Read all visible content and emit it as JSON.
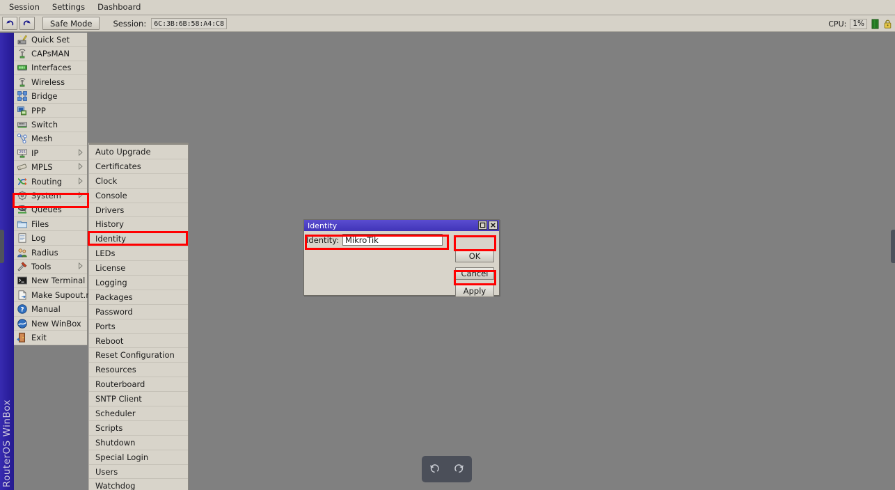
{
  "window": {
    "title": "RouterOS WinBox",
    "brand_vertical": "RouterOS WinBox"
  },
  "menubar": {
    "items": [
      {
        "label": "Session"
      },
      {
        "label": "Settings"
      },
      {
        "label": "Dashboard"
      }
    ]
  },
  "toolbar": {
    "undo_icon": "undo-arrow-icon",
    "redo_icon": "redo-arrow-icon",
    "safe_mode_label": "Safe Mode",
    "session_label": "Session:",
    "session_value": "6C:3B:6B:58:A4:C8",
    "cpu_label": "CPU:",
    "cpu_value": "1%",
    "memory_icon": "memory-bar-icon",
    "lock_icon": "lock-icon"
  },
  "sidebar": {
    "items": [
      {
        "label": "Quick Set",
        "icon": "quickset-icon",
        "arrow": false
      },
      {
        "label": "CAPsMAN",
        "icon": "capsman-icon",
        "arrow": false
      },
      {
        "label": "Interfaces",
        "icon": "interfaces-icon",
        "arrow": false
      },
      {
        "label": "Wireless",
        "icon": "wireless-icon",
        "arrow": false
      },
      {
        "label": "Bridge",
        "icon": "bridge-icon",
        "arrow": false
      },
      {
        "label": "PPP",
        "icon": "ppp-icon",
        "arrow": false
      },
      {
        "label": "Switch",
        "icon": "switch-icon",
        "arrow": false
      },
      {
        "label": "Mesh",
        "icon": "mesh-icon",
        "arrow": false
      },
      {
        "label": "IP",
        "icon": "ip-icon",
        "arrow": true
      },
      {
        "label": "MPLS",
        "icon": "mpls-icon",
        "arrow": true
      },
      {
        "label": "Routing",
        "icon": "routing-icon",
        "arrow": true
      },
      {
        "label": "System",
        "icon": "system-gear-icon",
        "arrow": true,
        "highlighted": true
      },
      {
        "label": "Queues",
        "icon": "queues-icon",
        "arrow": false
      },
      {
        "label": "Files",
        "icon": "files-folder-icon",
        "arrow": false
      },
      {
        "label": "Log",
        "icon": "log-icon",
        "arrow": false
      },
      {
        "label": "Radius",
        "icon": "radius-users-icon",
        "arrow": false
      },
      {
        "label": "Tools",
        "icon": "tools-icon",
        "arrow": true
      },
      {
        "label": "New Terminal",
        "icon": "terminal-icon",
        "arrow": false
      },
      {
        "label": "Make Supout.rif",
        "icon": "document-icon",
        "arrow": false
      },
      {
        "label": "Manual",
        "icon": "help-icon",
        "arrow": false
      },
      {
        "label": "New WinBox",
        "icon": "winbox-icon",
        "arrow": false
      },
      {
        "label": "Exit",
        "icon": "exit-door-icon",
        "arrow": false
      }
    ]
  },
  "submenu": {
    "parent": "System",
    "items": [
      {
        "label": "Auto Upgrade"
      },
      {
        "label": "Certificates"
      },
      {
        "label": "Clock"
      },
      {
        "label": "Console"
      },
      {
        "label": "Drivers"
      },
      {
        "label": "History"
      },
      {
        "label": "Identity",
        "highlighted": true
      },
      {
        "label": "LEDs"
      },
      {
        "label": "License"
      },
      {
        "label": "Logging"
      },
      {
        "label": "Packages"
      },
      {
        "label": "Password"
      },
      {
        "label": "Ports"
      },
      {
        "label": "Reboot"
      },
      {
        "label": "Reset Configuration"
      },
      {
        "label": "Resources"
      },
      {
        "label": "Routerboard"
      },
      {
        "label": "SNTP Client"
      },
      {
        "label": "Scheduler"
      },
      {
        "label": "Scripts"
      },
      {
        "label": "Shutdown"
      },
      {
        "label": "Special Login"
      },
      {
        "label": "Users"
      },
      {
        "label": "Watchdog"
      }
    ]
  },
  "dialog": {
    "title": "Identity",
    "maximize_icon": "maximize-icon",
    "close_icon": "close-icon",
    "identity_label": "Identity:",
    "identity_value": "MikroTik",
    "identity_placeholder": "",
    "buttons": {
      "ok": "OK",
      "cancel": "Cancel",
      "apply": "Apply"
    }
  },
  "nav_overlay": {
    "back_icon": "rotate-left-icon",
    "forward_icon": "rotate-right-icon"
  },
  "colors": {
    "accent_blue": "#2b1fa8",
    "titlebar_blue": "#4b3fc4",
    "chrome_gray": "#d8d4ca",
    "canvas_gray": "#808080",
    "highlight_red": "#ff0000"
  }
}
